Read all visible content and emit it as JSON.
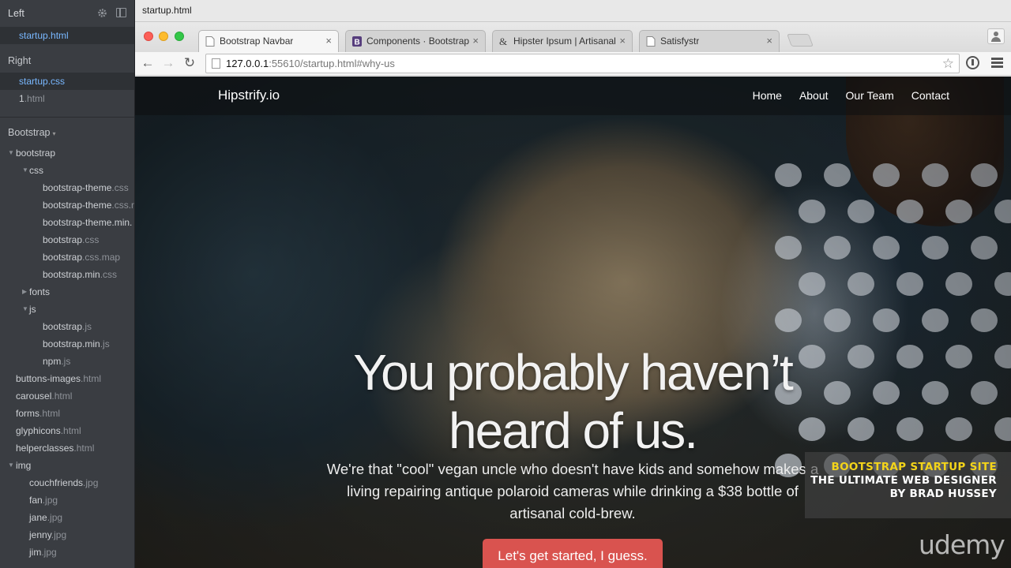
{
  "editor": {
    "tab_title": "startup.html",
    "left_header": "Left",
    "left_files": [
      {
        "name": "startup",
        "ext": ".html"
      }
    ],
    "right_header": "Right",
    "right_files": [
      {
        "name": "startup",
        "ext": ".css"
      },
      {
        "name": "1",
        "ext": ".html"
      }
    ],
    "project_label": "Bootstrap",
    "tree": [
      {
        "name": "bootstrap",
        "ext": "",
        "level": 0,
        "arrow": "down"
      },
      {
        "name": "css",
        "ext": "",
        "level": 1,
        "arrow": "down"
      },
      {
        "name": "bootstrap-theme",
        "ext": ".css",
        "level": 2
      },
      {
        "name": "bootstrap-theme",
        "ext": ".css.m",
        "level": 2
      },
      {
        "name": "bootstrap-theme.min.",
        "ext": "",
        "level": 2
      },
      {
        "name": "bootstrap",
        "ext": ".css",
        "level": 2
      },
      {
        "name": "bootstrap",
        "ext": ".css.map",
        "level": 2
      },
      {
        "name": "bootstrap.min",
        "ext": ".css",
        "level": 2
      },
      {
        "name": "fonts",
        "ext": "",
        "level": 1,
        "arrow": "right"
      },
      {
        "name": "js",
        "ext": "",
        "level": 1,
        "arrow": "down"
      },
      {
        "name": "bootstrap",
        "ext": ".js",
        "level": 2
      },
      {
        "name": "bootstrap.min",
        "ext": ".js",
        "level": 2
      },
      {
        "name": "npm",
        "ext": ".js",
        "level": 2
      },
      {
        "name": "buttons-images",
        "ext": ".html",
        "level": 0
      },
      {
        "name": "carousel",
        "ext": ".html",
        "level": 0
      },
      {
        "name": "forms",
        "ext": ".html",
        "level": 0
      },
      {
        "name": "glyphicons",
        "ext": ".html",
        "level": 0
      },
      {
        "name": "helperclasses",
        "ext": ".html",
        "level": 0
      },
      {
        "name": "img",
        "ext": "",
        "level": 0,
        "arrow": "down"
      },
      {
        "name": "couchfriends",
        "ext": ".jpg",
        "level": 1
      },
      {
        "name": "fan",
        "ext": ".jpg",
        "level": 1
      },
      {
        "name": "jane",
        "ext": ".jpg",
        "level": 1
      },
      {
        "name": "jenny",
        "ext": ".jpg",
        "level": 1
      },
      {
        "name": "jim",
        "ext": ".jpg",
        "level": 1
      }
    ]
  },
  "browser": {
    "tabs": [
      {
        "title": "Bootstrap Navbar",
        "icon": "page-icon",
        "active": true
      },
      {
        "title": "Components · Bootstrap",
        "icon": "bootstrap-icon",
        "active": false
      },
      {
        "title": "Hipster Ipsum | Artisanal fil",
        "icon": "ampersand-icon",
        "active": false
      },
      {
        "title": "Satisfystr",
        "icon": "page-icon",
        "active": false
      }
    ],
    "url_host": "127.0.0.1",
    "url_rest": ":55610/startup.html#why-us"
  },
  "page": {
    "brand": "Hipstrify.io",
    "nav": [
      "Home",
      "About",
      "Our Team",
      "Contact"
    ],
    "headline_line1": "You probably haven’t",
    "headline_line2": "heard of us.",
    "lead_line1": "We're that \"cool\" vegan uncle who doesn't have kids and somehow makes a",
    "lead_line2": "living repairing antique polaroid cameras while drinking a $38 bottle of",
    "lead_line3": "artisanal cold-brew.",
    "cta": "Let's get started, I guess.",
    "cta_color": "#d9534f"
  },
  "watermark": {
    "line1": "BOOTSTRAP STARTUP SITE",
    "line2": "THE ULTIMATE WEB DESIGNER",
    "line3": "BY BRAD HUSSEY",
    "line1_color": "#f3d41a",
    "brand": "udemy"
  }
}
